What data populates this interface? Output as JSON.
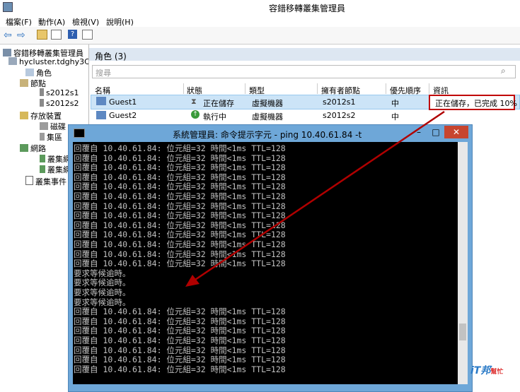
{
  "app": {
    "title": "容錯移轉叢集管理員"
  },
  "menu": [
    "檔案(F)",
    "動作(A)",
    "檢視(V)",
    "說明(H)"
  ],
  "tree": [
    {
      "label": "容錯移轉叢集管理員",
      "indent": 0
    },
    {
      "label": "hycluster.tdghy3C",
      "indent": 1
    },
    {
      "label": "角色",
      "indent": 2
    },
    {
      "label": "節點",
      "indent": 2
    },
    {
      "label": "s2012s1",
      "indent": 3
    },
    {
      "label": "s2012s2",
      "indent": 3
    },
    {
      "label": "存放裝置",
      "indent": 2
    },
    {
      "label": "磁碟",
      "indent": 3
    },
    {
      "label": "集區",
      "indent": 3
    },
    {
      "label": "網路",
      "indent": 2
    },
    {
      "label": "叢集網",
      "indent": 3
    },
    {
      "label": "叢集網",
      "indent": 3
    },
    {
      "label": "叢集事件",
      "indent": 2
    }
  ],
  "roles": {
    "title": "角色 (3)",
    "search_placeholder": "搜尋",
    "columns": [
      "名稱",
      "狀態",
      "類型",
      "擁有者節點",
      "優先順序",
      "資訊"
    ],
    "rows": [
      {
        "name": "Guest1",
        "status": "正在儲存",
        "type": "虛擬機器",
        "owner": "s2012s1",
        "priority": "中",
        "info": "正在儲存，已完成 10%"
      },
      {
        "name": "Guest2",
        "status": "執行中",
        "type": "虛擬機器",
        "owner": "s2012s2",
        "priority": "中",
        "info": ""
      }
    ]
  },
  "cmd": {
    "title": "系統管理員: 命令提示字元 - ping  10.40.61.84 -t",
    "lines": [
      "回覆自 10.40.61.84: 位元組=32 時間<1ms TTL=128",
      "回覆自 10.40.61.84: 位元組=32 時間<1ms TTL=128",
      "回覆自 10.40.61.84: 位元組=32 時間<1ms TTL=128",
      "回覆自 10.40.61.84: 位元組=32 時間<1ms TTL=128",
      "回覆自 10.40.61.84: 位元組=32 時間<1ms TTL=128",
      "回覆自 10.40.61.84: 位元組=32 時間<1ms TTL=128",
      "回覆自 10.40.61.84: 位元組=32 時間<1ms TTL=128",
      "回覆自 10.40.61.84: 位元組=32 時間<1ms TTL=128",
      "回覆自 10.40.61.84: 位元組=32 時間<1ms TTL=128",
      "回覆自 10.40.61.84: 位元組=32 時間<1ms TTL=128",
      "回覆自 10.40.61.84: 位元組=32 時間<1ms TTL=128",
      "回覆自 10.40.61.84: 位元組=32 時間<1ms TTL=128",
      "回覆自 10.40.61.84: 位元組=32 時間<1ms TTL=128",
      "要求等候逾時。",
      "要求等候逾時。",
      "要求等候逾時。",
      "要求等候逾時。",
      "回覆自 10.40.61.84: 位元組=32 時間<1ms TTL=128",
      "回覆自 10.40.61.84: 位元組=32 時間<1ms TTL=128",
      "回覆自 10.40.61.84: 位元組=32 時間<1ms TTL=128",
      "回覆自 10.40.61.84: 位元組=32 時間<1ms TTL=128",
      "回覆自 10.40.61.84: 位元組=32 時間<1ms TTL=128",
      "回覆自 10.40.61.84: 位元組=32 時間<1ms TTL=128",
      "回覆自 10.40.61.84: 位元組=32 時間<1ms TTL=128"
    ]
  },
  "watermark": {
    "brand": "iT邦",
    "sub": "幫忙"
  },
  "colors": {
    "highlight_box": "#c00000",
    "arrow": "#b00000",
    "selected_row": "#cce4f7",
    "cmd_frame": "#6ea7d8"
  }
}
